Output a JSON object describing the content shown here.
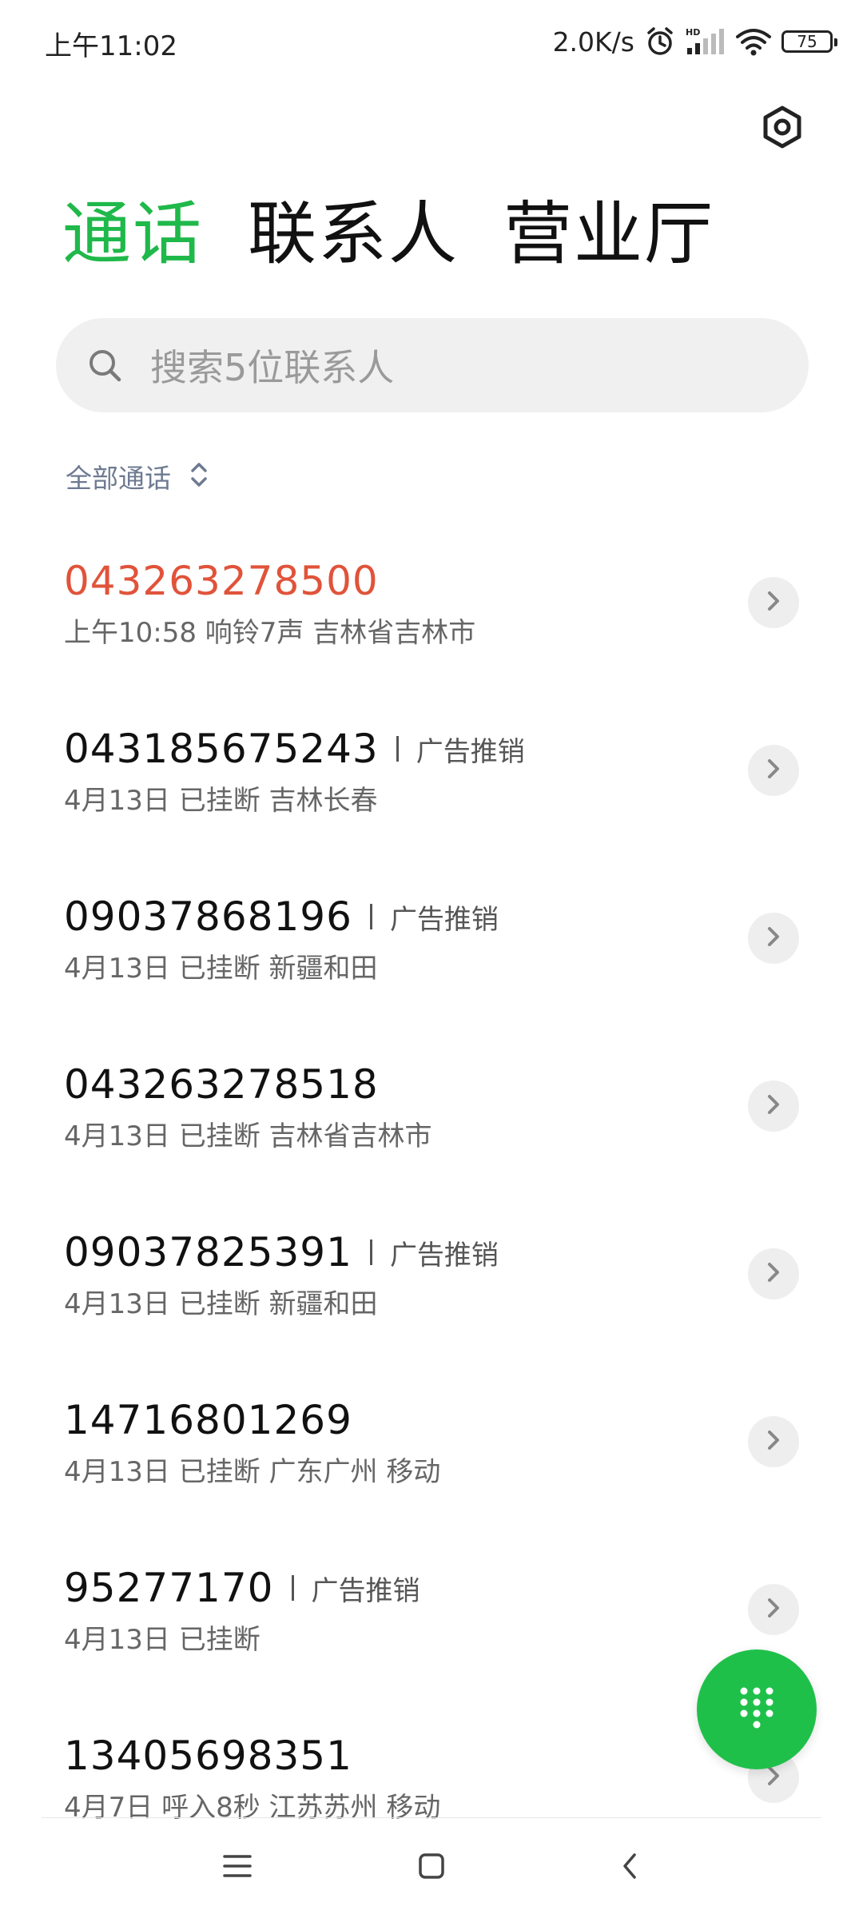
{
  "status_bar": {
    "time": "上午11:02",
    "net_speed": "2.0K/s",
    "battery": "75"
  },
  "tabs": [
    {
      "label": "通话",
      "active": true
    },
    {
      "label": "联系人",
      "active": false
    },
    {
      "label": "营业厅",
      "active": false
    }
  ],
  "search": {
    "placeholder": "搜索5位联系人"
  },
  "filter": {
    "label": "全部通话"
  },
  "calls": [
    {
      "number": "043263278500",
      "tag": "",
      "detail": "上午10:58 响铃7声 吉林省吉林市",
      "missed": true
    },
    {
      "number": "043185675243",
      "tag": "广告推销",
      "detail": "4月13日 已挂断 吉林长春",
      "missed": false
    },
    {
      "number": "09037868196",
      "tag": "广告推销",
      "detail": "4月13日 已挂断 新疆和田",
      "missed": false
    },
    {
      "number": "043263278518",
      "tag": "",
      "detail": "4月13日 已挂断 吉林省吉林市",
      "missed": false
    },
    {
      "number": "09037825391",
      "tag": "广告推销",
      "detail": "4月13日 已挂断 新疆和田",
      "missed": false
    },
    {
      "number": "14716801269",
      "tag": "",
      "detail": "4月13日 已挂断 广东广州 移动",
      "missed": false
    },
    {
      "number": "95277170",
      "tag": "广告推销",
      "detail": "4月13日 已挂断",
      "missed": false
    },
    {
      "number": "13405698351",
      "tag": "",
      "detail": "4月7日 呼入8秒 江苏苏州 移动",
      "missed": false
    }
  ],
  "colors": {
    "accent": "#1fb84a",
    "missed": "#e0533a"
  }
}
